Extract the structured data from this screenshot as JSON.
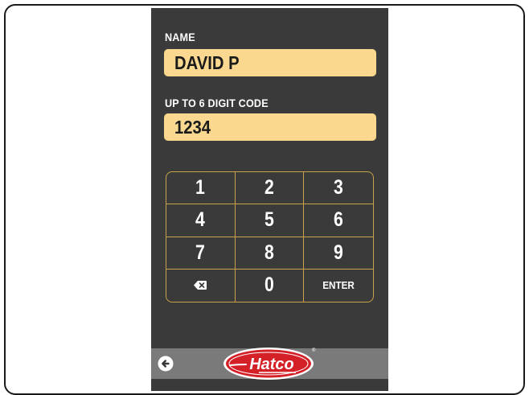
{
  "login": {
    "name_label": "NAME",
    "name_value": "DAVID P",
    "code_label": "UP TO 6 DIGIT CODE",
    "code_value": "1234"
  },
  "keypad": {
    "keys": [
      "1",
      "2",
      "3",
      "4",
      "5",
      "6",
      "7",
      "8",
      "9"
    ],
    "zero": "0",
    "enter": "ENTER",
    "backspace_icon": "backspace-icon"
  },
  "footer": {
    "back_icon": "back-arrow-icon",
    "logo_text": "Hatco",
    "logo_mark": "®"
  },
  "colors": {
    "panel": "#3a3a3a",
    "field": "#fbd890",
    "keypad_border": "#c9a24a",
    "footer": "#7a7a7a",
    "logo_red": "#d42027"
  }
}
